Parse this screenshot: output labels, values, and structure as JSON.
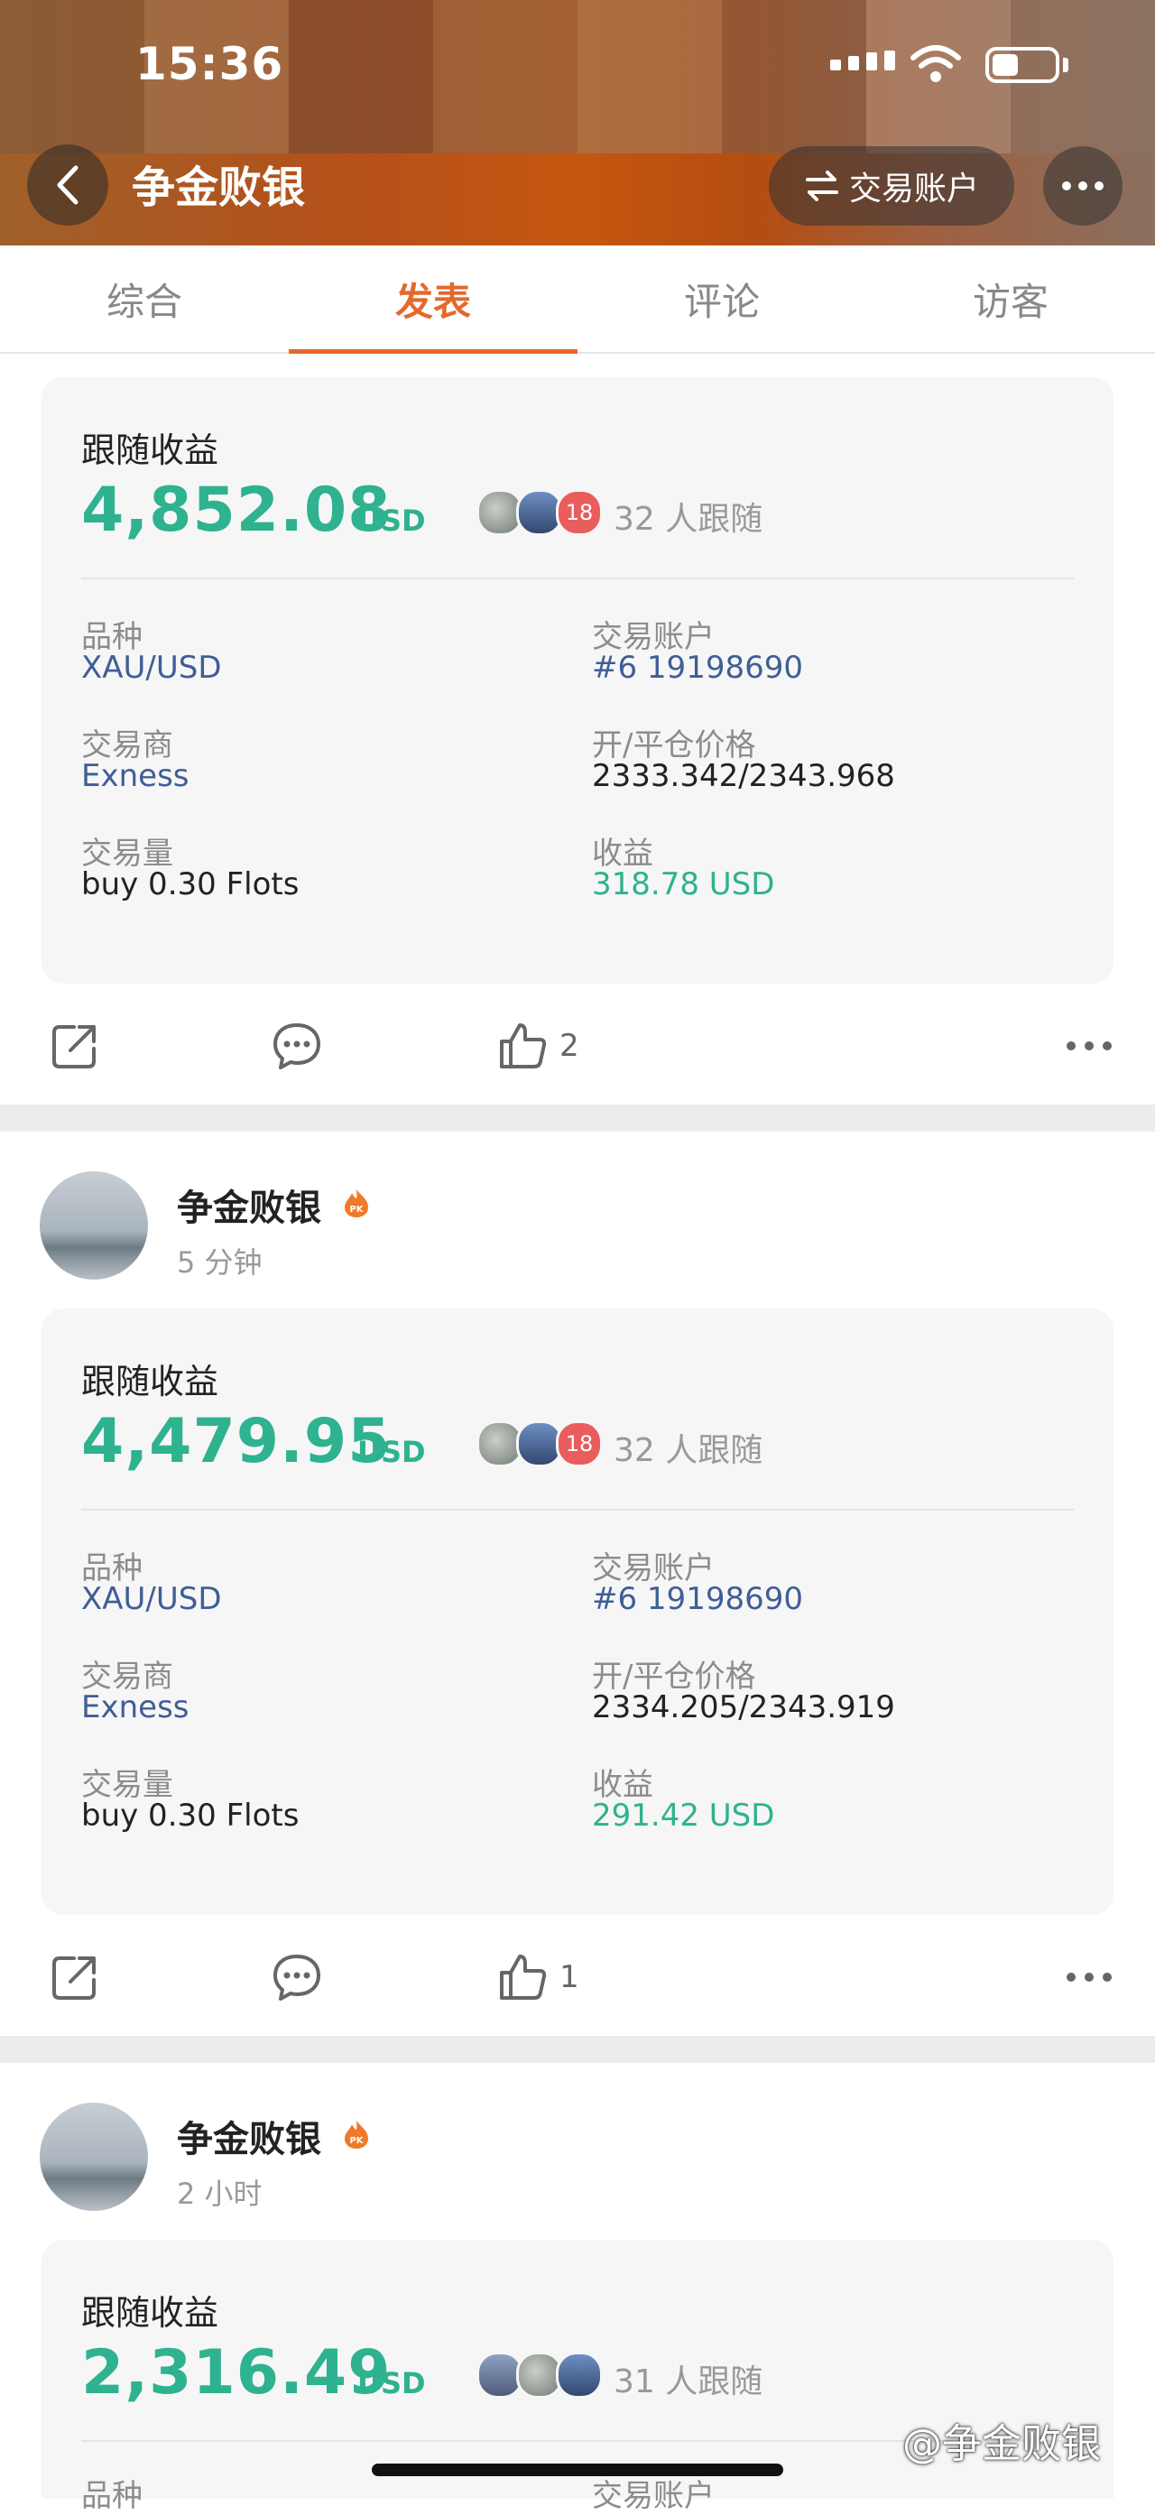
{
  "status": {
    "time": "15:36"
  },
  "header": {
    "title": "争金败银",
    "account_button": "交易账户"
  },
  "tabs": [
    {
      "label": "综合"
    },
    {
      "label": "发表"
    },
    {
      "label": "评论"
    },
    {
      "label": "访客"
    }
  ],
  "colors": {
    "accent": "#e5682b",
    "profit_green": "#2eb28f",
    "link_blue": "#3f5e96"
  },
  "posts": [
    {
      "card": {
        "label": "跟随收益",
        "value": "4,852.08",
        "currency": "USD",
        "avatar_badge": "18",
        "followers": "32 人跟随",
        "f1_label": "品种",
        "f1_value": "XAU/USD",
        "f2_label": "交易账户",
        "f2_value": "#6 19198690",
        "f3_label": "交易商",
        "f3_value": "Exness",
        "f4_label": "开/平仓价格",
        "f4_value": "2333.342/2343.968",
        "f5_label": "交易量",
        "f5_value": "buy 0.30 Flots",
        "f6_label": "收益",
        "f6_value": "318.78 USD"
      },
      "likes": "2"
    },
    {
      "author": "争金败银",
      "time": "5 分钟",
      "card": {
        "label": "跟随收益",
        "value": "4,479.95",
        "currency": "USD",
        "avatar_badge": "18",
        "followers": "32 人跟随",
        "f1_label": "品种",
        "f1_value": "XAU/USD",
        "f2_label": "交易账户",
        "f2_value": "#6 19198690",
        "f3_label": "交易商",
        "f3_value": "Exness",
        "f4_label": "开/平仓价格",
        "f4_value": "2334.205/2343.919",
        "f5_label": "交易量",
        "f5_value": "buy 0.30 Flots",
        "f6_label": "收益",
        "f6_value": "291.42 USD"
      },
      "likes": "1"
    },
    {
      "author": "争金败银",
      "time": "2 小时",
      "card": {
        "label": "跟随收益",
        "value": "2,316.49",
        "currency": "USD",
        "followers": "31 人跟随",
        "f1_label": "品种",
        "f2_label": "交易账户"
      }
    }
  ],
  "watermark": "@争金败银"
}
